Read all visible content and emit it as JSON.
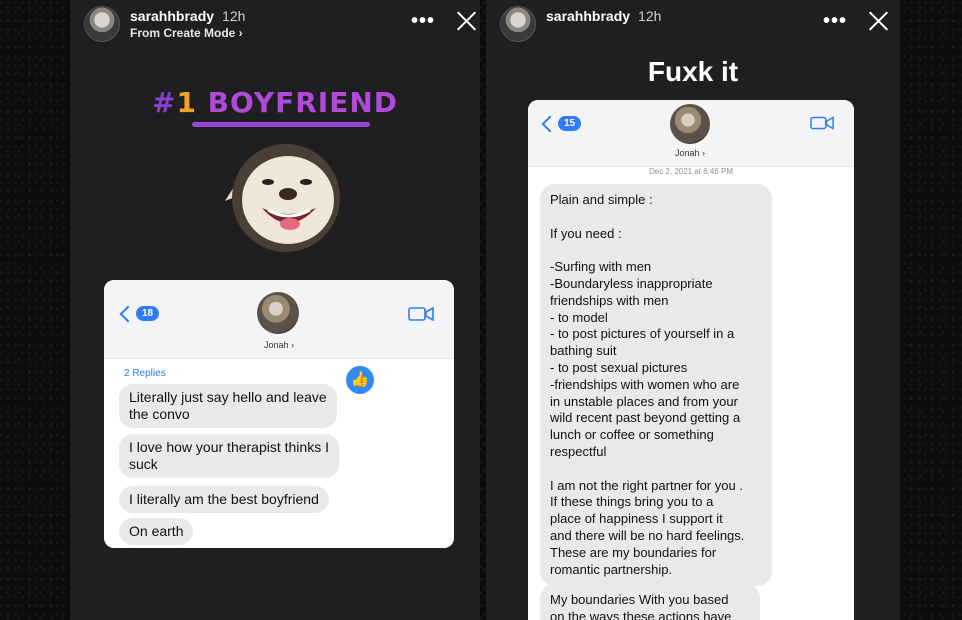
{
  "left_story": {
    "username": "sarahhbrady",
    "time": "12h",
    "subtitle": "From Create Mode ›",
    "sticker": {
      "hash": "#",
      "number": "1",
      "word": "BOYFRIEND"
    },
    "chat": {
      "back_count": "18",
      "contact": "Jonah ›",
      "replies": "2 Replies",
      "like_icon": "thumbs-up-icon",
      "messages": [
        "Literally just say hello and leave\nthe convo",
        "I love how your therapist thinks I\nsuck",
        "I literally am the best boyfriend",
        "On earth"
      ]
    }
  },
  "right_story": {
    "username": "sarahhbrady",
    "time": "12h",
    "overlay_text": "Fuxk it",
    "chat": {
      "back_count": "15",
      "contact": "Jonah ›",
      "timestamp": "Dec 2, 2021 at 6:46 PM",
      "message_lines": [
        "Plain and simple :",
        "",
        "If you need :",
        "",
        "-Surfing with men",
        "-Boundaryless inappropriate",
        "friendships with men",
        "- to model",
        "- to post pictures of yourself in a",
        "bathing suit",
        "- to post sexual pictures",
        "-friendships with women who are",
        "in unstable places and from your",
        "wild recent past beyond getting a",
        "lunch or coffee or something",
        "respectful",
        "",
        "I am not the right partner for you .",
        "If these things bring you to a",
        "place of happiness I support it",
        "and there will be no hard feelings.",
        "These are my boundaries for",
        "romantic partnership."
      ],
      "second_message_lines": [
        "My boundaries With you based",
        "on the ways these actions have"
      ]
    }
  },
  "colors": {
    "imessage_blue": "#2f7cf6",
    "sticker_purple": "#b04bd9",
    "sticker_orange": "#f0a22a"
  }
}
